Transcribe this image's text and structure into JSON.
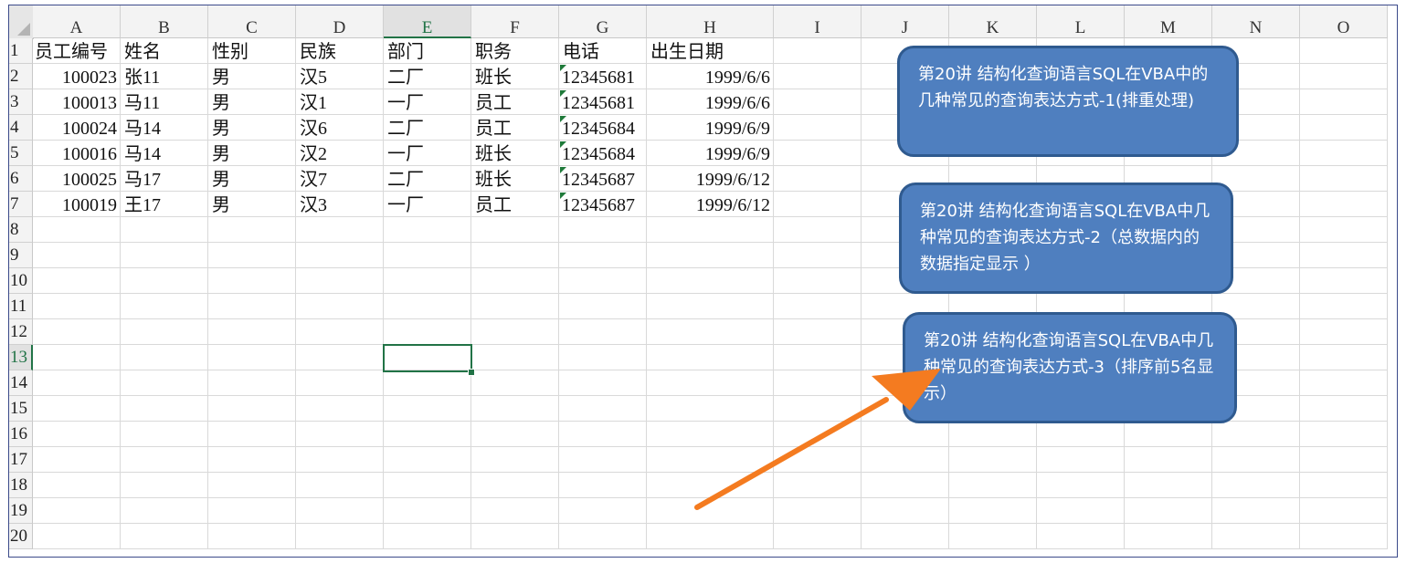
{
  "columns": [
    "A",
    "B",
    "C",
    "D",
    "E",
    "F",
    "G",
    "H",
    "I",
    "J",
    "K",
    "L",
    "M",
    "N",
    "O"
  ],
  "rows": [
    "1",
    "2",
    "3",
    "4",
    "5",
    "6",
    "7",
    "8",
    "9",
    "10",
    "11",
    "12",
    "13",
    "14",
    "15",
    "16",
    "17",
    "18",
    "19",
    "20"
  ],
  "active_column": "E",
  "active_row": "13",
  "header_row": [
    "员工编号",
    "姓名",
    "性别",
    "民族",
    "部门",
    "职务",
    "电话",
    "出生日期"
  ],
  "data_rows": [
    [
      "100023",
      "张11",
      "男",
      "汉5",
      "二厂",
      "班长",
      "12345681",
      "1999/6/6"
    ],
    [
      "100013",
      "马11",
      "男",
      "汉1",
      "一厂",
      "员工",
      "12345681",
      "1999/6/6"
    ],
    [
      "100024",
      "马14",
      "男",
      "汉6",
      "二厂",
      "员工",
      "12345684",
      "1999/6/9"
    ],
    [
      "100016",
      "马14",
      "男",
      "汉2",
      "一厂",
      "班长",
      "12345684",
      "1999/6/9"
    ],
    [
      "100025",
      "马17",
      "男",
      "汉7",
      "二厂",
      "班长",
      "12345687",
      "1999/6/12"
    ],
    [
      "100019",
      "王17",
      "男",
      "汉3",
      "一厂",
      "员工",
      "12345687",
      "1999/6/12"
    ]
  ],
  "shapes": [
    {
      "text": "第20讲 结构化查询语言SQL在VBA中的几种常见的查询表达方式-1(排重处理)"
    },
    {
      "text": "第20讲 结构化查询语言SQL在VBA中几种常见的查询表达方式-2（总数据内的数据指定显示 ）"
    },
    {
      "text": "第20讲 结构化查询语言SQL在VBA中几种常见的查询表达方式-3（排序前5名显示）"
    }
  ],
  "colors": {
    "shape_fill": "#4f7fbf",
    "shape_border": "#2f5a8f",
    "arrow": "#f47b20",
    "selection": "#217346",
    "text_indicator": "#1f7a3a"
  }
}
